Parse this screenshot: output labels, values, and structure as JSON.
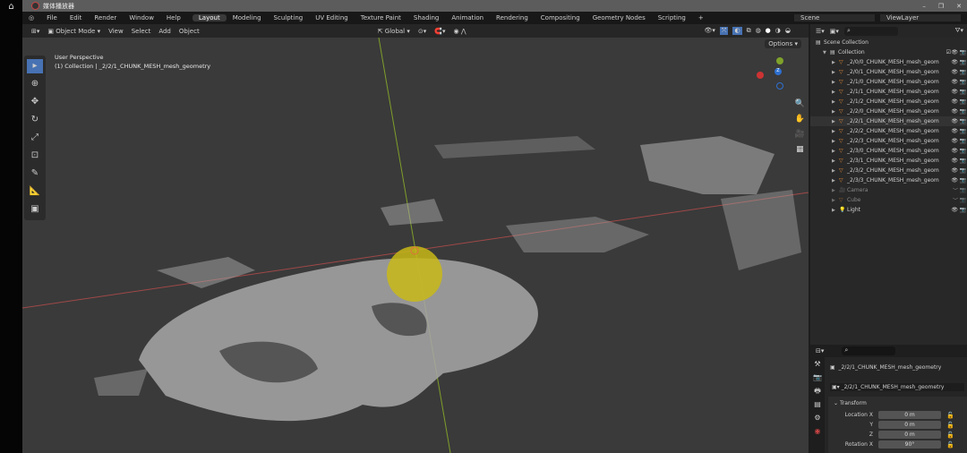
{
  "window": {
    "title": "媒体播放器"
  },
  "menu": [
    "File",
    "Edit",
    "Render",
    "Window",
    "Help"
  ],
  "workspaces": [
    "Layout",
    "Modeling",
    "Sculpting",
    "UV Editing",
    "Texture Paint",
    "Shading",
    "Animation",
    "Rendering",
    "Compositing",
    "Geometry Nodes",
    "Scripting",
    "+"
  ],
  "active_workspace": "Layout",
  "scene": {
    "label": "Scene",
    "view_layer": "ViewLayer"
  },
  "viewport_header": {
    "mode": "Object Mode",
    "menus": [
      "View",
      "Select",
      "Add",
      "Object"
    ],
    "orientation": "Global",
    "options": "Options"
  },
  "viewport": {
    "perspective": "User Perspective",
    "collection_info": "(1) Collection | _2/2/1_CHUNK_MESH_mesh_geometry"
  },
  "outliner": {
    "scene_collection": "Scene Collection",
    "collection": "Collection",
    "items": [
      {
        "name": "_2/0/0_CHUNK_MESH_mesh_geom"
      },
      {
        "name": "_2/0/1_CHUNK_MESH_mesh_geom"
      },
      {
        "name": "_2/1/0_CHUNK_MESH_mesh_geom"
      },
      {
        "name": "_2/1/1_CHUNK_MESH_mesh_geom"
      },
      {
        "name": "_2/1/2_CHUNK_MESH_mesh_geom"
      },
      {
        "name": "_2/2/0_CHUNK_MESH_mesh_geom"
      },
      {
        "name": "_2/2/1_CHUNK_MESH_mesh_geom"
      },
      {
        "name": "_2/2/2_CHUNK_MESH_mesh_geom"
      },
      {
        "name": "_2/2/3_CHUNK_MESH_mesh_geom"
      },
      {
        "name": "_2/3/0_CHUNK_MESH_mesh_geom"
      },
      {
        "name": "_2/3/1_CHUNK_MESH_mesh_geom"
      },
      {
        "name": "_2/3/2_CHUNK_MESH_mesh_geom"
      },
      {
        "name": "_2/3/3_CHUNK_MESH_mesh_geom"
      }
    ],
    "others": [
      "Camera",
      "Cube",
      "Light"
    ]
  },
  "properties": {
    "object_name": "_2/2/1_CHUNK_MESH_mesh_geometry",
    "data_name": "_2/2/1_CHUNK_MESH_mesh_geometry",
    "panel": "Transform",
    "fields": [
      {
        "label": "Location X",
        "value": "0 m"
      },
      {
        "label": "Y",
        "value": "0 m"
      },
      {
        "label": "Z",
        "value": "0 m"
      },
      {
        "label": "Rotation X",
        "value": "90°"
      }
    ]
  }
}
